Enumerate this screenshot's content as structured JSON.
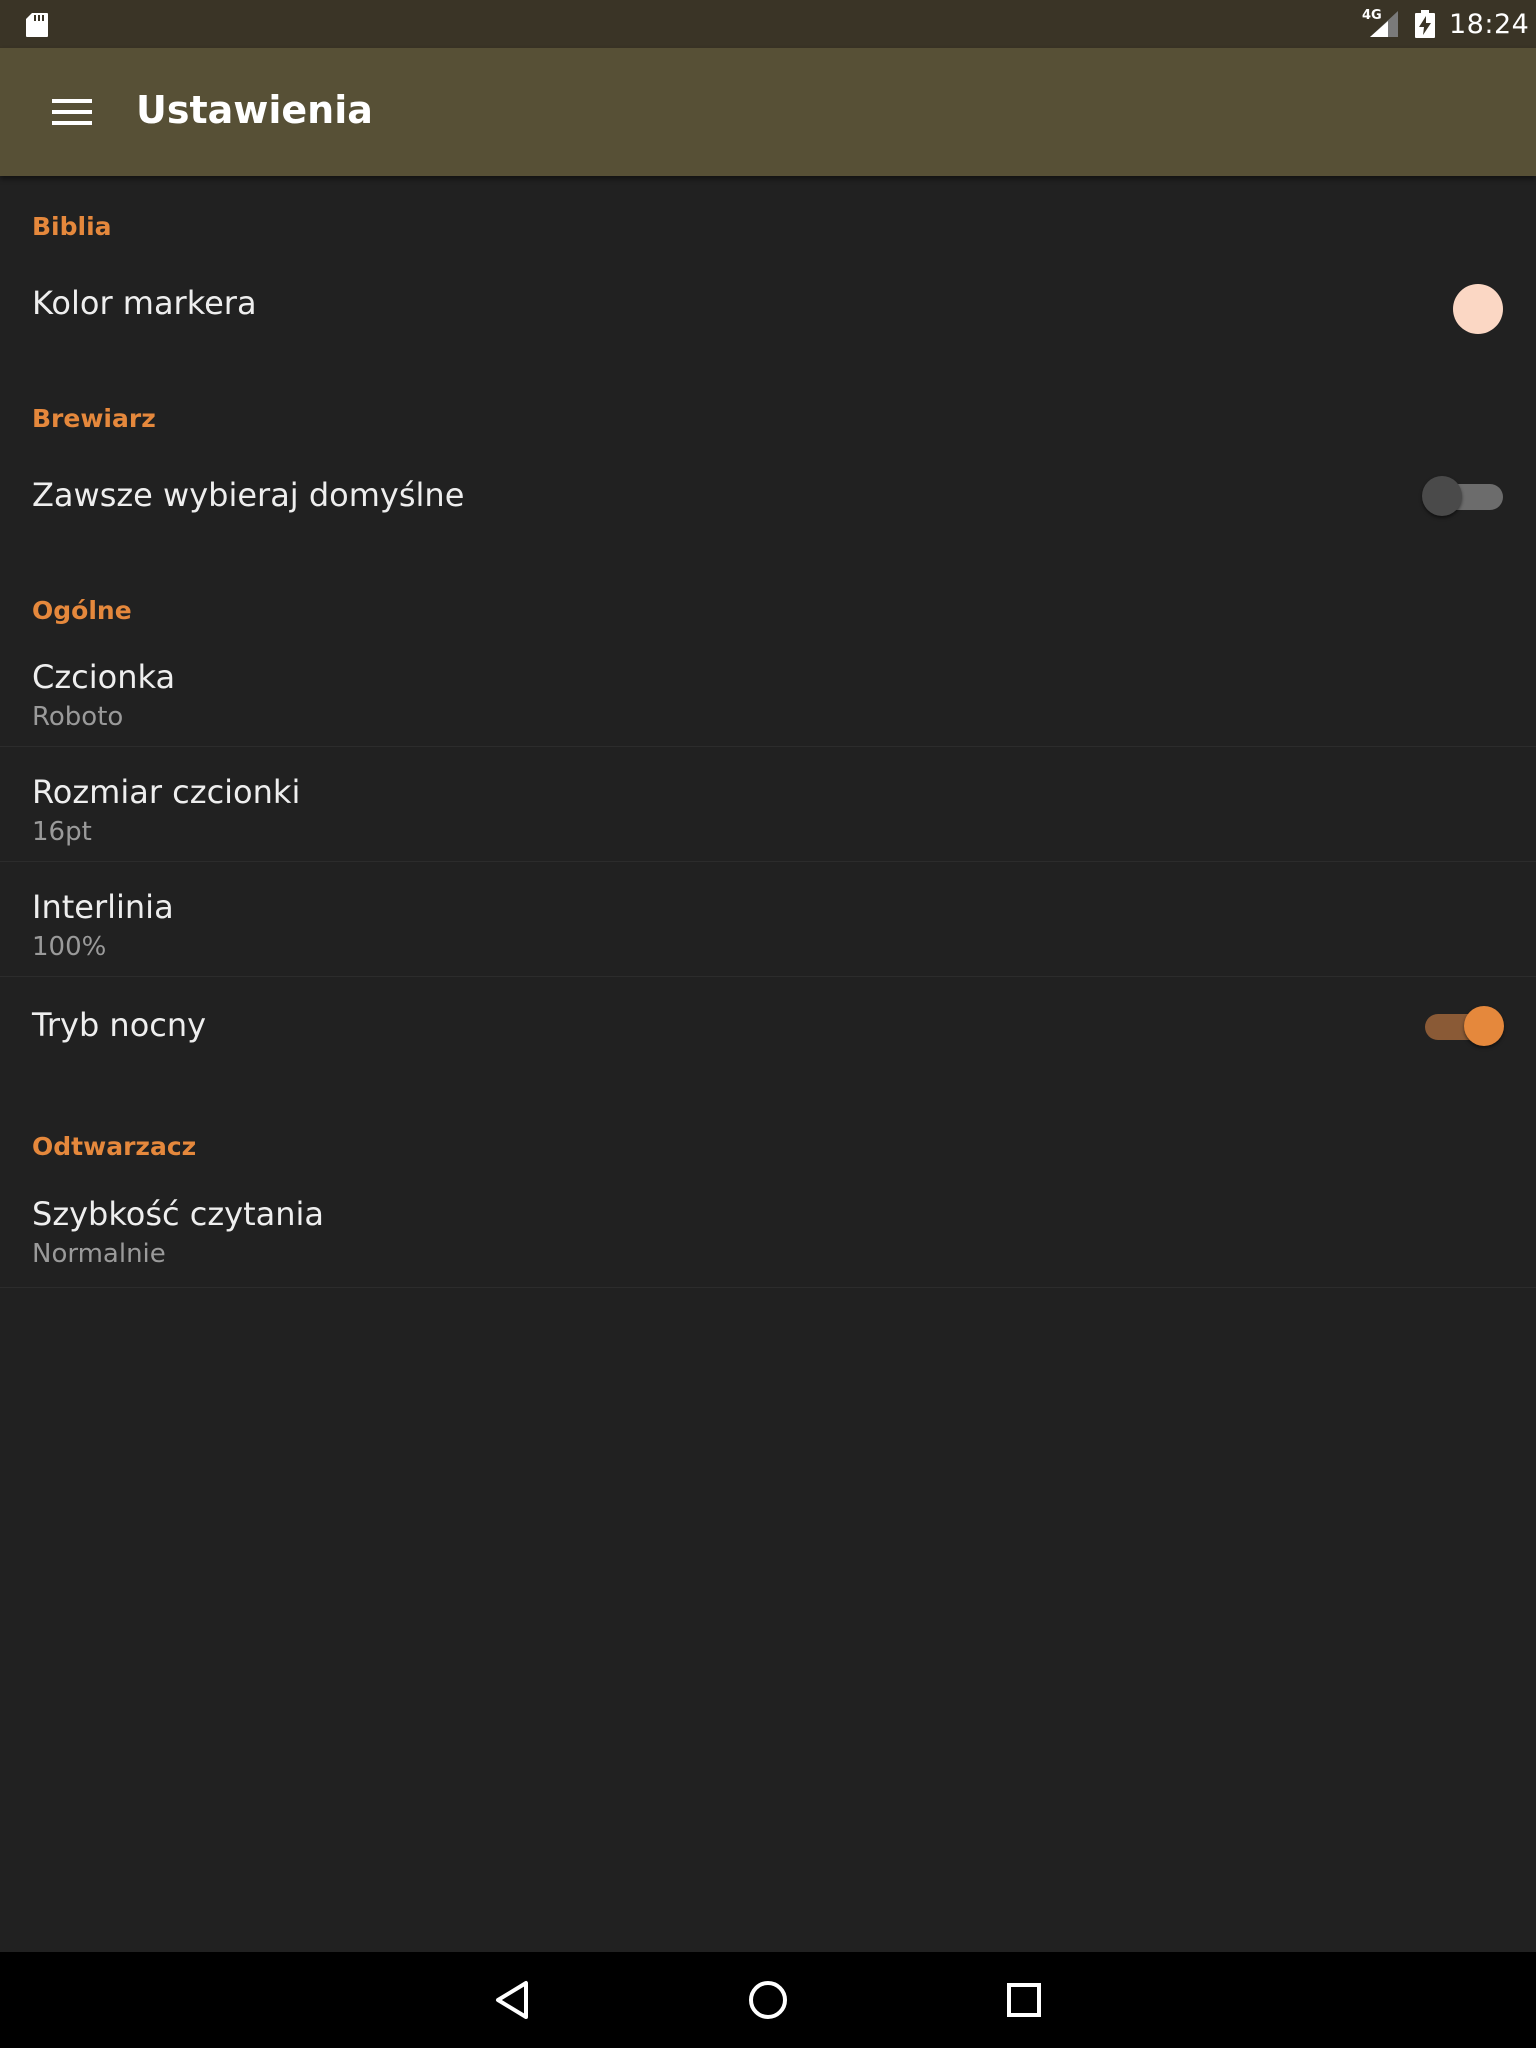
{
  "status_bar": {
    "network": "4G",
    "time": "18:24",
    "icons": [
      "sd-card-icon",
      "signal-icon",
      "battery-charging-icon"
    ]
  },
  "app_bar": {
    "title": "Ustawienia",
    "menu_icon": "hamburger-menu-icon"
  },
  "sections": {
    "biblia": {
      "header": "Biblia",
      "marker_color": {
        "title": "Kolor markera",
        "color": "#fbd7c4"
      }
    },
    "brewiarz": {
      "header": "Brewiarz",
      "always_default": {
        "title": "Zawsze wybieraj domyślne",
        "enabled": false
      }
    },
    "ogolne": {
      "header": "Ogólne",
      "font": {
        "title": "Czcionka",
        "summary": "Roboto"
      },
      "font_size": {
        "title": "Rozmiar czcionki",
        "summary": "16pt"
      },
      "line_spacing": {
        "title": "Interlinia",
        "summary": "100%"
      },
      "night_mode": {
        "title": "Tryb nocny",
        "enabled": true
      }
    },
    "odtwarzacz": {
      "header": "Odtwarzacz",
      "reading_speed": {
        "title": "Szybkość czytania",
        "summary": "Normalnie"
      }
    }
  },
  "colors": {
    "accent": "#e5883c",
    "app_bar": "#575036",
    "status_bar": "#3a3426",
    "background": "#212121"
  },
  "nav_bar": {
    "icons": [
      "back-icon",
      "home-icon",
      "recents-icon"
    ]
  }
}
